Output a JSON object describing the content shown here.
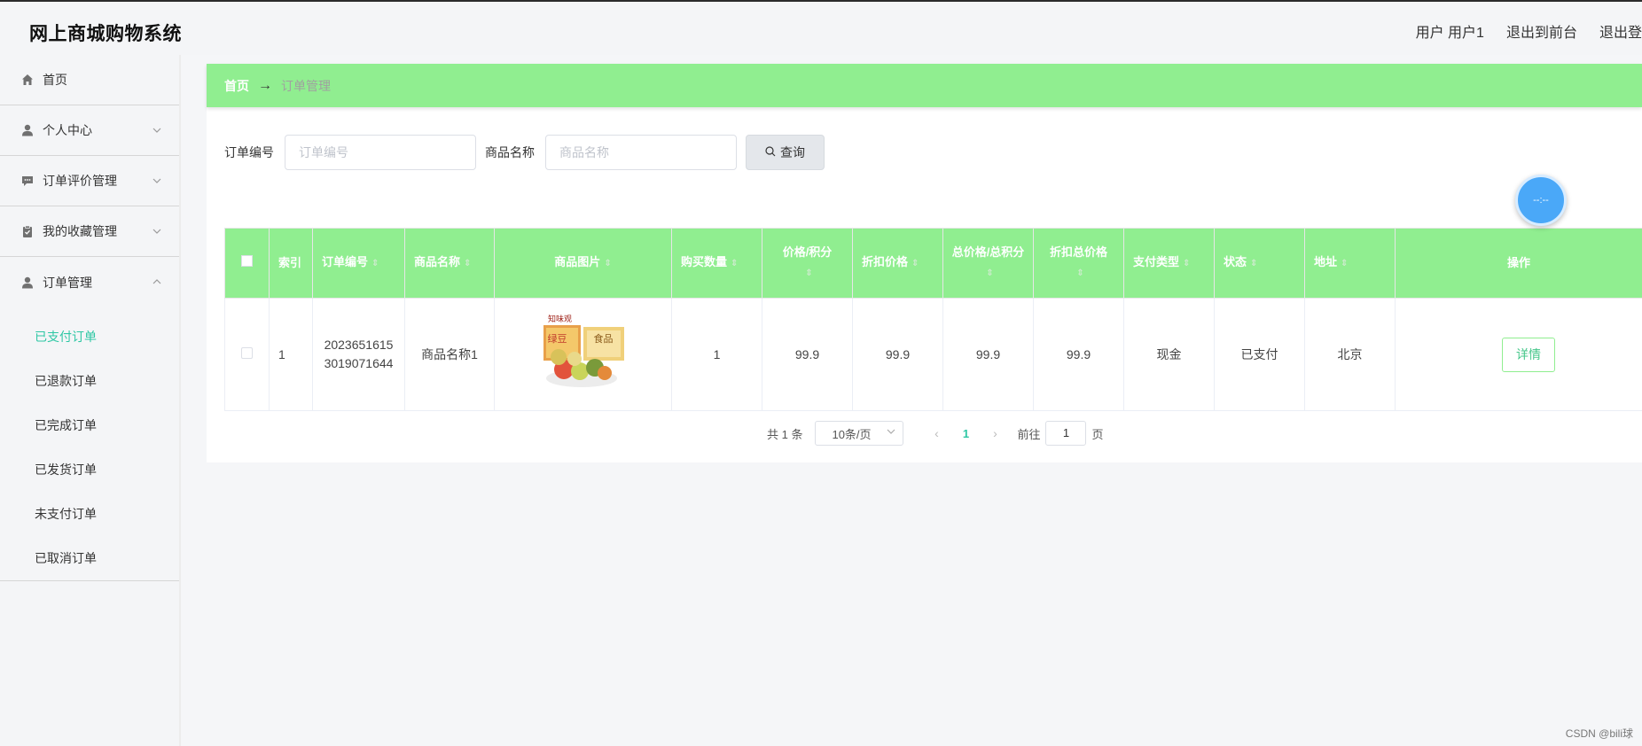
{
  "app": {
    "title": "网上商城购物系统"
  },
  "header": {
    "user_label": "用户 用户1",
    "front_link": "退出到前台",
    "logout_link": "退出登"
  },
  "sidebar": {
    "items": [
      {
        "label": "首页",
        "icon": "home-icon"
      },
      {
        "label": "个人中心",
        "icon": "user-icon"
      },
      {
        "label": "订单评价管理",
        "icon": "comment-icon"
      },
      {
        "label": "我的收藏管理",
        "icon": "clipboard-icon"
      },
      {
        "label": "订单管理",
        "icon": "user-icon"
      }
    ],
    "submenu": [
      {
        "label": "已支付订单"
      },
      {
        "label": "已退款订单"
      },
      {
        "label": "已完成订单"
      },
      {
        "label": "已发货订单"
      },
      {
        "label": "未支付订单"
      },
      {
        "label": "已取消订单"
      }
    ]
  },
  "breadcrumb": {
    "home": "首页",
    "separator": "→",
    "current": "订单管理"
  },
  "search": {
    "order_label": "订单编号",
    "order_placeholder": "订单编号",
    "product_label": "商品名称",
    "product_placeholder": "商品名称",
    "button_label": "查询"
  },
  "table": {
    "headers": [
      "索引",
      "订单编号",
      "商品名称",
      "商品图片",
      "购买数量",
      "价格/积分",
      "折扣价格",
      "总价格/总积分",
      "折扣总价格",
      "支付类型",
      "状态",
      "地址",
      "操作"
    ],
    "rows": [
      {
        "index": "1",
        "order_no": "20236516153019071644",
        "product_name": "商品名称1",
        "quantity": "1",
        "price": "99.9",
        "discount_price": "99.9",
        "total_price": "99.9",
        "discount_total": "99.9",
        "payment_type": "现金",
        "status": "已支付",
        "address": "北京",
        "action_label": "详情"
      }
    ]
  },
  "float_ball": {
    "label": "--:--"
  },
  "product_image": {
    "brand_text": "知味观",
    "box_text_1": "绿豆",
    "box_text_2": "食品"
  },
  "pagination": {
    "total": "共 1 条",
    "page_size": "10条/页",
    "current_page": "1",
    "goto_label": "前往",
    "goto_value": "1",
    "page_unit": "页",
    "prev_icon": "‹",
    "next_icon": "›"
  },
  "watermark": "CSDN @bili球",
  "colors": {
    "accent_green": "#90ee90",
    "active_text": "#2ec7a4"
  }
}
